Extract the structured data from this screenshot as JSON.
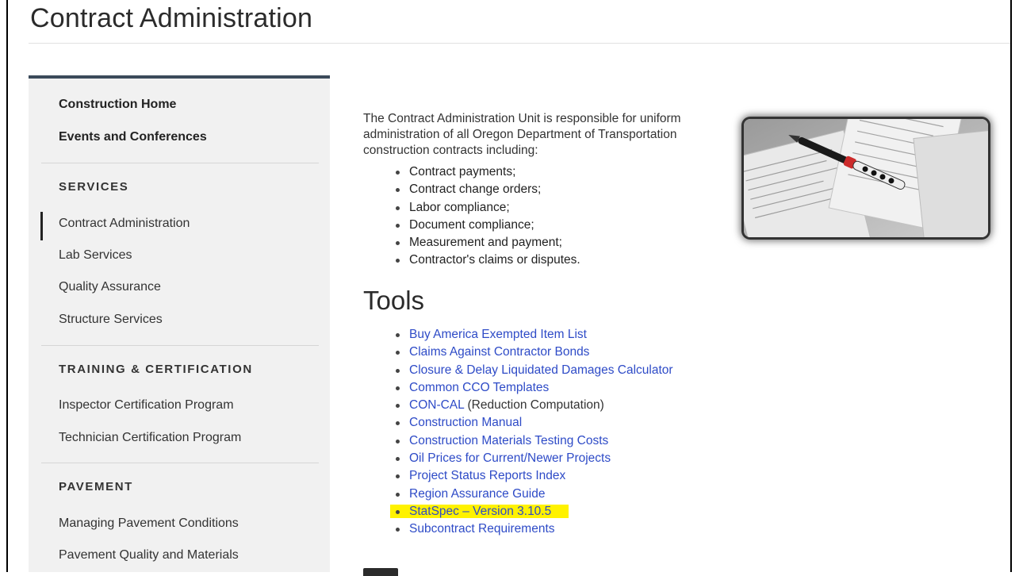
{
  "page": {
    "title": "Contract Administration"
  },
  "sidebar": {
    "top_links": [
      "Construction Home",
      "Events and Conferences"
    ],
    "sections": [
      {
        "heading": "SERVICES",
        "items": [
          "Contract Administration",
          "Lab Services",
          "Quality Assurance",
          "Structure Services"
        ]
      },
      {
        "heading": "TRAINING & CERTIFICATION",
        "items": [
          "Inspector Certification Program",
          "Technician Certification Program"
        ]
      },
      {
        "heading": "PAVEMENT",
        "items": [
          "Managing Pavement Conditions",
          "Pavement Quality and Materials"
        ]
      }
    ],
    "active_item": "Contract Administration"
  },
  "main": {
    "intro": "The Contract Administration Unit is responsible for uniform administration of all Oregon Department of Transportation construction contracts including:",
    "bullets": [
      "Contract payments;",
      "Contract change orders;",
      "Labor compliance;",
      "Document compliance;",
      "Measurement and payment;",
      "Contractor's claims or disputes."
    ],
    "tools_heading": "Tools",
    "tools": [
      {
        "link": "Buy America Exempted Item List",
        "suffix": ""
      },
      {
        "link": "Claims Against Contractor Bonds",
        "suffix": ""
      },
      {
        "link": "Closure & Delay Liquidated Damages Calculator",
        "suffix": ""
      },
      {
        "link": "Common CCO Templates",
        "suffix": ""
      },
      {
        "link": "CON-CAL",
        "suffix": " (Reduction Computation)"
      },
      {
        "link": "Construction Manual",
        "suffix": ""
      },
      {
        "link": "Construction Materials Testing Costs",
        "suffix": ""
      },
      {
        "link": "Oil Prices for Current/Newer Projects",
        "suffix": ""
      },
      {
        "link": "Project Status Reports Index",
        "suffix": ""
      },
      {
        "link": "Region Assurance Guide",
        "suffix": ""
      },
      {
        "link": "StatSpec – Version 3.10.5",
        "suffix": ""
      },
      {
        "link": "Subcontract Requirements",
        "suffix": ""
      }
    ],
    "highlighted_tool": "StatSpec – Version 3.10.5",
    "highlight_color": "#fff200",
    "link_color": "#2e4bc7"
  },
  "image": {
    "icon": "pen-on-documents-photo"
  }
}
